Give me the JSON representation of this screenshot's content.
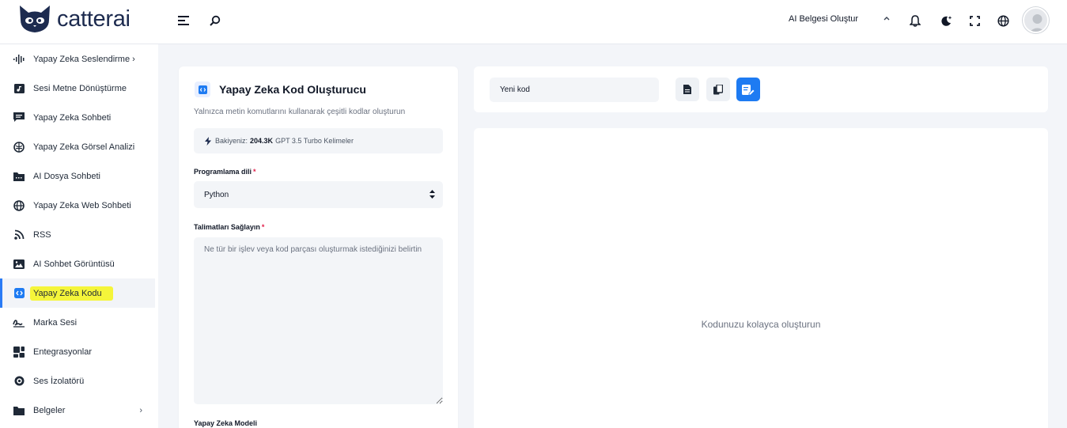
{
  "brand": {
    "name": "catterai"
  },
  "header": {
    "create_document_label": "AI Belgesi Oluştur",
    "icons": [
      "menu-icon",
      "search-icon",
      "bell-icon",
      "theme-toggle-icon",
      "fullscreen-icon",
      "globe-icon"
    ]
  },
  "sidebar": {
    "items": [
      {
        "label": "Yapay Zeka Seslendirme",
        "icon": "waveform-icon",
        "chevron": "›"
      },
      {
        "label": "Sesi Metne Dönüştürme",
        "icon": "music-file-icon",
        "chevron": ""
      },
      {
        "label": "Yapay Zeka Sohbeti",
        "icon": "chat-icon",
        "chevron": ""
      },
      {
        "label": "Yapay Zeka Görsel Analizi",
        "icon": "brain-icon",
        "chevron": ""
      },
      {
        "label": "AI Dosya Sohbeti",
        "icon": "folder-icon",
        "chevron": ""
      },
      {
        "label": "Yapay Zeka Web Sohbeti",
        "icon": "globe-icon",
        "chevron": ""
      },
      {
        "label": "RSS",
        "icon": "rss-icon",
        "chevron": ""
      },
      {
        "label": "AI Sohbet Görüntüsü",
        "icon": "image-icon",
        "chevron": ""
      },
      {
        "label": "Yapay Zeka Kodu",
        "icon": "code-icon",
        "chevron": "",
        "active": true
      },
      {
        "label": "Marka Sesi",
        "icon": "signature-icon",
        "chevron": ""
      },
      {
        "label": "Entegrasyonlar",
        "icon": "widgets-icon",
        "chevron": ""
      },
      {
        "label": "Ses İzolatörü",
        "icon": "disc-icon",
        "chevron": ""
      },
      {
        "label": "Belgeler",
        "icon": "folder-icon",
        "chevron": "›"
      }
    ]
  },
  "form": {
    "title": "Yapay Zeka Kod Oluşturucu",
    "subtitle": "Yalnızca metin komutlarını kullanarak çeşitli kodlar oluşturun",
    "balance_prefix": "Bakiyeniz:",
    "balance_value": "204.3K",
    "balance_suffix": "GPT 3.5 Turbo Kelimeler",
    "language_label": "Programlama dili",
    "language_value": "Python",
    "instructions_label": "Talimatları Sağlayın",
    "instructions_placeholder": "Ne tür bir işlev veya kod parçası oluşturmak istediğinizi belirtin",
    "model_label": "Yapay Zeka Modeli",
    "required_mark": "*"
  },
  "toolbar": {
    "code_name_value": "Yeni kod"
  },
  "result": {
    "empty_message": "Kodunuzu kolayca oluşturun"
  },
  "colors": {
    "accent": "#1e7bf2",
    "highlight": "#f5f53a",
    "required": "#e11d48"
  }
}
